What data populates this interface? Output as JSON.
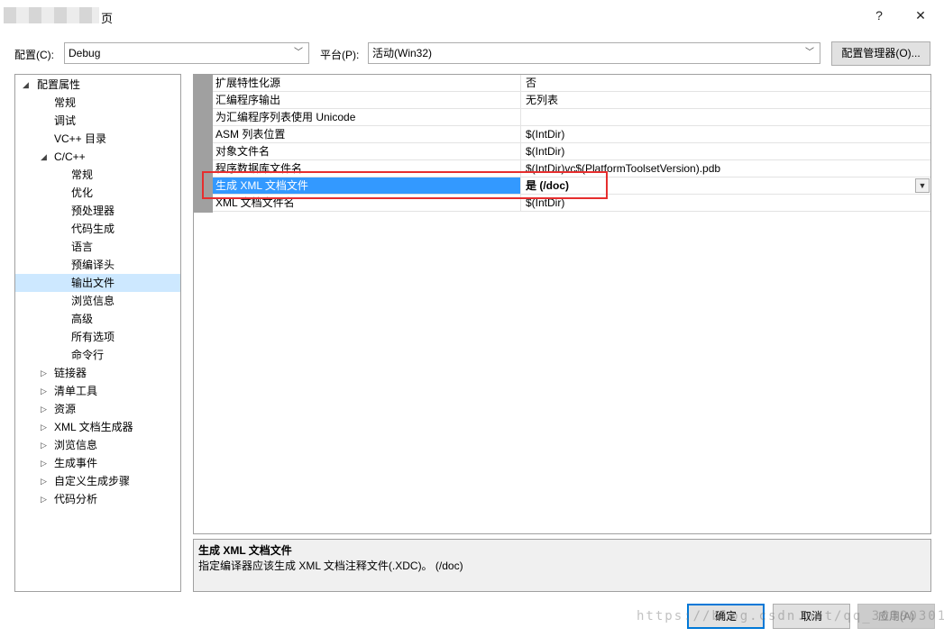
{
  "window": {
    "title_suffix": "页",
    "help_glyph": "?",
    "close_glyph": "✕"
  },
  "config": {
    "config_label": "配置(C):",
    "config_value": "Debug",
    "platform_label": "平台(P):",
    "platform_value": "活动(Win32)",
    "manager_button": "配置管理器(O)..."
  },
  "tree": [
    {
      "label": "配置属性",
      "expander": "◢",
      "level": 0
    },
    {
      "label": "常规",
      "level": 1
    },
    {
      "label": "调试",
      "level": 1
    },
    {
      "label": "VC++ 目录",
      "level": 1
    },
    {
      "label": "C/C++",
      "expander": "◢",
      "level": 1
    },
    {
      "label": "常规",
      "level": 2
    },
    {
      "label": "优化",
      "level": 2
    },
    {
      "label": "预处理器",
      "level": 2
    },
    {
      "label": "代码生成",
      "level": 2
    },
    {
      "label": "语言",
      "level": 2
    },
    {
      "label": "预编译头",
      "level": 2
    },
    {
      "label": "输出文件",
      "level": 2,
      "selected": true
    },
    {
      "label": "浏览信息",
      "level": 2
    },
    {
      "label": "高级",
      "level": 2
    },
    {
      "label": "所有选项",
      "level": 2
    },
    {
      "label": "命令行",
      "level": 2
    },
    {
      "label": "链接器",
      "expander": "▷",
      "level": 1
    },
    {
      "label": "清单工具",
      "expander": "▷",
      "level": 1
    },
    {
      "label": "资源",
      "expander": "▷",
      "level": 1
    },
    {
      "label": "XML 文档生成器",
      "expander": "▷",
      "level": 1
    },
    {
      "label": "浏览信息",
      "expander": "▷",
      "level": 1
    },
    {
      "label": "生成事件",
      "expander": "▷",
      "level": 1
    },
    {
      "label": "自定义生成步骤",
      "expander": "▷",
      "level": 1
    },
    {
      "label": "代码分析",
      "expander": "▷",
      "level": 1
    }
  ],
  "properties": [
    {
      "name": "扩展特性化源",
      "value": "否"
    },
    {
      "name": "汇编程序输出",
      "value": "无列表"
    },
    {
      "name": "为汇编程序列表使用 Unicode",
      "value": ""
    },
    {
      "name": "ASM 列表位置",
      "value": "$(IntDir)"
    },
    {
      "name": "对象文件名",
      "value": "$(IntDir)"
    },
    {
      "name": "程序数据库文件名",
      "value": "$(IntDir)vc$(PlatformToolsetVersion).pdb"
    },
    {
      "name": "生成 XML 文档文件",
      "value": "是 (/doc)",
      "selected": true
    },
    {
      "name": "XML 文档文件名",
      "value": "$(IntDir)"
    }
  ],
  "description": {
    "title": "生成 XML 文档文件",
    "text": "指定编译器应该生成 XML 文档注释文件(.XDC)。    (/doc)"
  },
  "buttons": {
    "ok": "确定",
    "cancel": "取消",
    "apply": "应用(A)"
  },
  "watermark": "https://blog.csdn.net/qq_36390301",
  "colors": {
    "selection": "#3399ff",
    "highlight_box": "#e62e2e",
    "tree_selection": "#cde8ff"
  }
}
